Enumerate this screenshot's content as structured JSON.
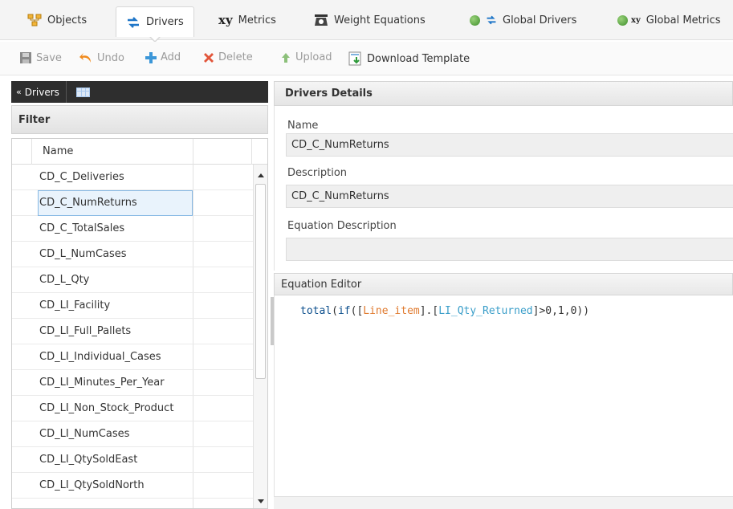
{
  "tabs": [
    {
      "label": "Objects",
      "icon": "objects-icon",
      "active": false
    },
    {
      "label": "Drivers",
      "icon": "drivers-icon",
      "active": true
    },
    {
      "label": "Metrics",
      "icon": "metrics-xy-icon",
      "active": false
    },
    {
      "label": "Weight Equations",
      "icon": "weight-scale-icon",
      "active": false
    },
    {
      "label": "Global Drivers",
      "icon": "global-drivers-icon",
      "active": false
    },
    {
      "label": "Global Metrics",
      "icon": "global-metrics-icon",
      "active": false
    }
  ],
  "toolbar": {
    "save": "Save",
    "undo": "Undo",
    "add": "Add",
    "delete": "Delete",
    "upload": "Upload",
    "download": "Download Template"
  },
  "left_panel": {
    "title": "Drivers",
    "filter": "Filter",
    "column_header": "Name",
    "rows": [
      "CD_C_Deliveries",
      "CD_C_NumReturns",
      "CD_C_TotalSales",
      "CD_L_NumCases",
      "CD_L_Qty",
      "CD_LI_Facility",
      "CD_LI_Full_Pallets",
      "CD_LI_Individual_Cases",
      "CD_LI_Minutes_Per_Year",
      "CD_LI_Non_Stock_Product",
      "CD_LI_NumCases",
      "CD_LI_QtySoldEast",
      "CD_LI_QtySoldNorth"
    ],
    "selected_index": 1
  },
  "details": {
    "title": "Drivers Details",
    "name_label": "Name",
    "name_value": "CD_C_NumReturns",
    "description_label": "Description",
    "description_value": "CD_C_NumReturns",
    "equation_description_label": "Equation Description",
    "equation_description_value": ""
  },
  "editor": {
    "title": "Equation Editor",
    "code": {
      "fn_total": "total",
      "paren1": "(",
      "fn_if": "if",
      "paren2": "([",
      "obj": "Line_item",
      "mid": "].[",
      "field": "LI_Qty_Returned",
      "rest": "]>0,1,0))"
    }
  },
  "colors": {
    "code_keyword": "#0b4e8c",
    "code_object": "#e07a2e",
    "code_field": "#3a9ec9",
    "selected_row": "#e9f3fc"
  }
}
